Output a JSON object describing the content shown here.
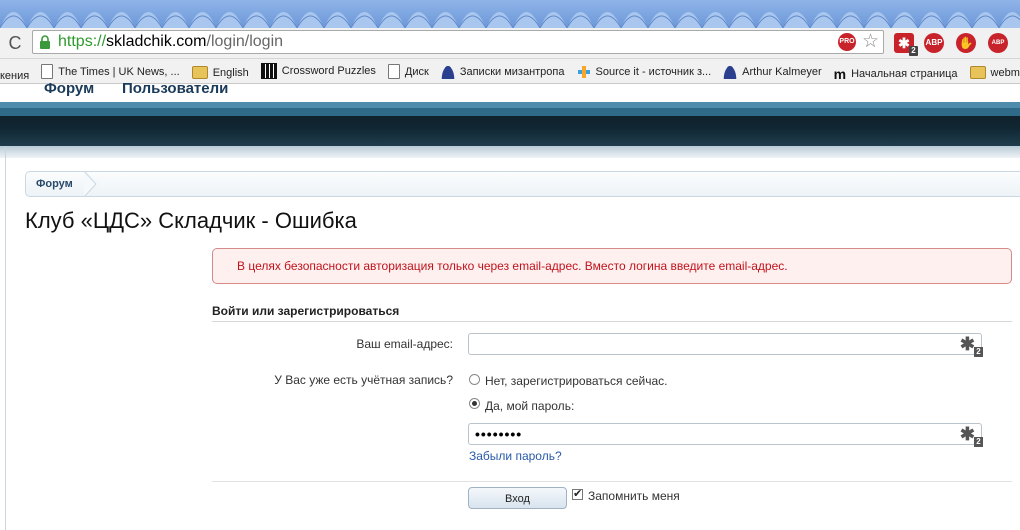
{
  "browser": {
    "url_scheme": "https://",
    "url_host": "skladchik.com",
    "url_path": "/login/login",
    "pro_icon_text": "PRO",
    "lastpass_badge": "2",
    "abp_text": "ABP",
    "abp2_text": "ABP"
  },
  "bookmarks": [
    {
      "label": "кения",
      "icon": "none"
    },
    {
      "label": "The Times | UK News, ...",
      "icon": "page"
    },
    {
      "label": "English",
      "icon": "folder"
    },
    {
      "label": "Crossword Puzzles",
      "icon": "grid"
    },
    {
      "label": "Диск",
      "icon": "page"
    },
    {
      "label": "Записки мизантропа",
      "icon": "person"
    },
    {
      "label": "Source it - источник з...",
      "icon": "source"
    },
    {
      "label": "Arthur Kalmeyer",
      "icon": "person"
    },
    {
      "label": "Начальная страница",
      "icon": "m"
    },
    {
      "label": "webm",
      "icon": "folder"
    }
  ],
  "nav": {
    "forum": "Форум",
    "users": "Пользователи"
  },
  "breadcrumb": {
    "forum": "Форум"
  },
  "page_title": "Клуб «ЦДС» Складчик - Ошибка",
  "error_message": "В целях безопасности авторизация только через email-адрес. Вместо логина введите email-адрес.",
  "form": {
    "header": "Войти или зарегистрироваться",
    "email_label": "Ваш email-адрес:",
    "email_value": "",
    "account_question": "У Вас уже есть учётная запись?",
    "option_register": "Нет, зарегистрироваться сейчас.",
    "option_password": "Да, мой пароль:",
    "password_value": "••••••••",
    "lastpass_count": "2",
    "forgot_password": "Забыли пароль?",
    "login_button": "Вход",
    "remember_me": "Запомнить меня"
  }
}
